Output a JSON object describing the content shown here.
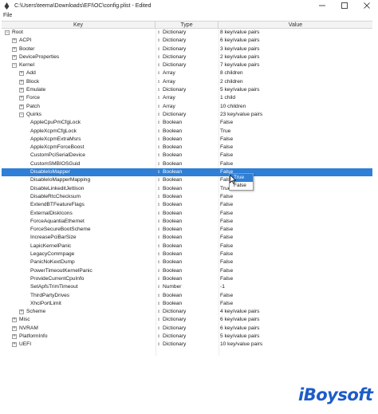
{
  "window": {
    "title": "C:\\Users\\teema\\Downloads\\EFI\\OC\\config.plist - Edited"
  },
  "menu": {
    "file": "File"
  },
  "columns": {
    "key": "Key",
    "type": "Type",
    "value": "Value"
  },
  "rows": [
    {
      "key": "Root",
      "type": "Dictionary",
      "value": "8 key/value pairs",
      "indent": 0,
      "toggle": "minus"
    },
    {
      "key": "ACPI",
      "type": "Dictionary",
      "value": "6 key/value pairs",
      "indent": 1,
      "toggle": "plus"
    },
    {
      "key": "Booter",
      "type": "Dictionary",
      "value": "3 key/value pairs",
      "indent": 1,
      "toggle": "plus"
    },
    {
      "key": "DeviceProperties",
      "type": "Dictionary",
      "value": "2 key/value pairs",
      "indent": 1,
      "toggle": "plus"
    },
    {
      "key": "Kernel",
      "type": "Dictionary",
      "value": "7 key/value pairs",
      "indent": 1,
      "toggle": "minus"
    },
    {
      "key": "Add",
      "type": "Array",
      "value": "8 children",
      "indent": 2,
      "toggle": "plus"
    },
    {
      "key": "Block",
      "type": "Array",
      "value": "2 children",
      "indent": 2,
      "toggle": "plus"
    },
    {
      "key": "Emulate",
      "type": "Dictionary",
      "value": "5 key/value pairs",
      "indent": 2,
      "toggle": "plus"
    },
    {
      "key": "Force",
      "type": "Array",
      "value": "1 child",
      "indent": 2,
      "toggle": "plus"
    },
    {
      "key": "Patch",
      "type": "Array",
      "value": "10 children",
      "indent": 2,
      "toggle": "plus"
    },
    {
      "key": "Quirks",
      "type": "Dictionary",
      "value": "23 key/value pairs",
      "indent": 2,
      "toggle": "minus"
    },
    {
      "key": "AppleCpuPmCfgLock",
      "type": "Boolean",
      "value": "False",
      "indent": 3,
      "toggle": ""
    },
    {
      "key": "AppleXcpmCfgLock",
      "type": "Boolean",
      "value": "True",
      "indent": 3,
      "toggle": ""
    },
    {
      "key": "AppleXcpmExtraMsrs",
      "type": "Boolean",
      "value": "False",
      "indent": 3,
      "toggle": ""
    },
    {
      "key": "AppleXcpmForceBoost",
      "type": "Boolean",
      "value": "False",
      "indent": 3,
      "toggle": ""
    },
    {
      "key": "CustomPciSerialDevice",
      "type": "Boolean",
      "value": "False",
      "indent": 3,
      "toggle": ""
    },
    {
      "key": "CustomSMBIOSGuid",
      "type": "Boolean",
      "value": "False",
      "indent": 3,
      "toggle": ""
    },
    {
      "key": "DisableIoMapper",
      "type": "Boolean",
      "value": "False",
      "indent": 3,
      "toggle": "",
      "selected": true
    },
    {
      "key": "DisableIoMapperMapping",
      "type": "Boolean",
      "value": "False",
      "indent": 3,
      "toggle": ""
    },
    {
      "key": "DisableLinkeditJettison",
      "type": "Boolean",
      "value": "True",
      "indent": 3,
      "toggle": ""
    },
    {
      "key": "DisableRtcChecksum",
      "type": "Boolean",
      "value": "False",
      "indent": 3,
      "toggle": ""
    },
    {
      "key": "ExtendBTFeatureFlags",
      "type": "Boolean",
      "value": "False",
      "indent": 3,
      "toggle": ""
    },
    {
      "key": "ExternalDiskIcons",
      "type": "Boolean",
      "value": "False",
      "indent": 3,
      "toggle": ""
    },
    {
      "key": "ForceAquantiaEthernet",
      "type": "Boolean",
      "value": "False",
      "indent": 3,
      "toggle": ""
    },
    {
      "key": "ForceSecureBootScheme",
      "type": "Boolean",
      "value": "False",
      "indent": 3,
      "toggle": ""
    },
    {
      "key": "IncreasePciBarSize",
      "type": "Boolean",
      "value": "False",
      "indent": 3,
      "toggle": ""
    },
    {
      "key": "LapicKernelPanic",
      "type": "Boolean",
      "value": "False",
      "indent": 3,
      "toggle": ""
    },
    {
      "key": "LegacyCommpage",
      "type": "Boolean",
      "value": "False",
      "indent": 3,
      "toggle": ""
    },
    {
      "key": "PanicNoKextDump",
      "type": "Boolean",
      "value": "False",
      "indent": 3,
      "toggle": ""
    },
    {
      "key": "PowerTimeoutKernelPanic",
      "type": "Boolean",
      "value": "False",
      "indent": 3,
      "toggle": ""
    },
    {
      "key": "ProvideCurrentCpuInfo",
      "type": "Boolean",
      "value": "False",
      "indent": 3,
      "toggle": ""
    },
    {
      "key": "SetApfsTrimTimeout",
      "type": "Number",
      "value": "-1",
      "indent": 3,
      "toggle": ""
    },
    {
      "key": "ThirdPartyDrives",
      "type": "Boolean",
      "value": "False",
      "indent": 3,
      "toggle": ""
    },
    {
      "key": "XhciPortLimit",
      "type": "Boolean",
      "value": "False",
      "indent": 3,
      "toggle": ""
    },
    {
      "key": "Scheme",
      "type": "Dictionary",
      "value": "4 key/value pairs",
      "indent": 2,
      "toggle": "plus"
    },
    {
      "key": "Misc",
      "type": "Dictionary",
      "value": "6 key/value pairs",
      "indent": 1,
      "toggle": "plus"
    },
    {
      "key": "NVRAM",
      "type": "Dictionary",
      "value": "6 key/value pairs",
      "indent": 1,
      "toggle": "plus"
    },
    {
      "key": "PlatformInfo",
      "type": "Dictionary",
      "value": "5 key/value pairs",
      "indent": 1,
      "toggle": "plus"
    },
    {
      "key": "UEFI",
      "type": "Dictionary",
      "value": "10 key/value pairs",
      "indent": 1,
      "toggle": "plus"
    }
  ],
  "popup": {
    "options": [
      "True",
      "False"
    ],
    "highlighted": "True"
  },
  "watermark": {
    "text": "iBoysoft"
  },
  "colors": {
    "selection": "#2f7fd6",
    "logo": "#1d5cc9"
  }
}
